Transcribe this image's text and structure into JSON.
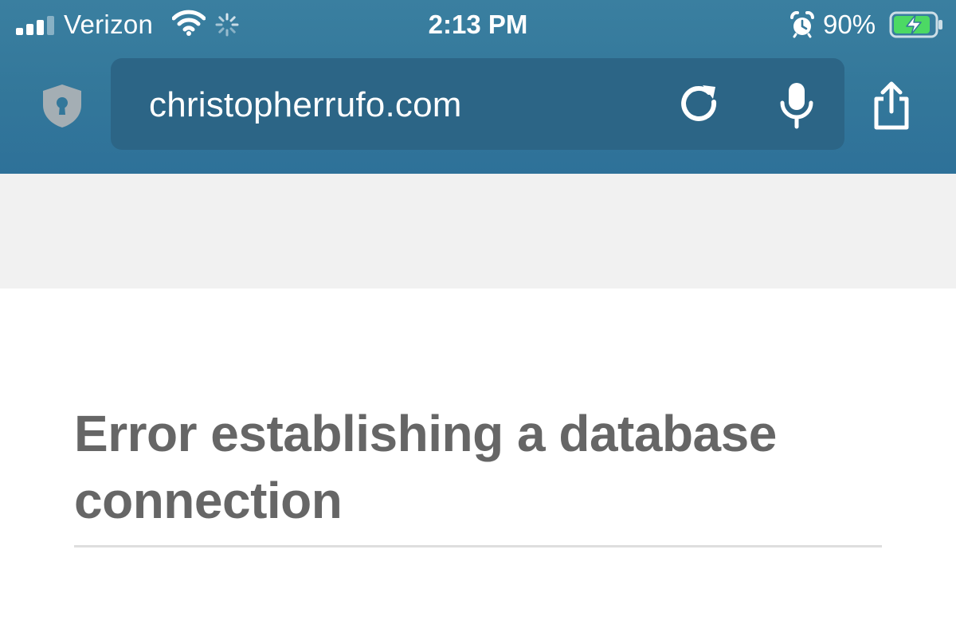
{
  "status_bar": {
    "carrier": "Verizon",
    "time": "2:13 PM",
    "battery_percent": "90%",
    "battery_level": 0.9,
    "signal_bars_active": 3,
    "signal_bars_total": 4,
    "icons": [
      "signal-icon",
      "wifi-icon",
      "activity-spinner-icon",
      "alarm-icon",
      "battery-charging-icon"
    ]
  },
  "browser": {
    "url": "christopherrufo.com",
    "icons": [
      "privacy-shield-icon",
      "reload-icon",
      "microphone-icon",
      "share-icon"
    ],
    "toolbar_color": "#33779a",
    "url_bar_color": "#2c6586"
  },
  "page": {
    "error_title": "Error establishing a database connection",
    "text_color": "#666666",
    "band_color": "#f1f1f1"
  }
}
